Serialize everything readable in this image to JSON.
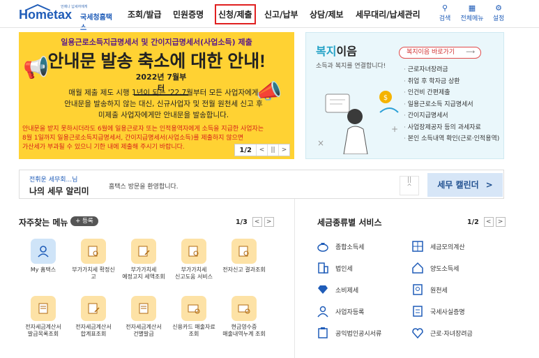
{
  "header": {
    "logo_sub": "언제나 납세자에게",
    "logo_main": "Hometax",
    "logo_kr": "국세청홈택스",
    "nav": [
      "조회/발급",
      "민원증명",
      "신청/제출",
      "신고/납부",
      "상담/제보",
      "세무대리/납세관리"
    ],
    "utils": {
      "search": "검색",
      "allmenu": "전체메뉴",
      "settings": "설정"
    }
  },
  "banner": {
    "line1": "일용근로소득지급명세서 및 간이지급명세서(사업소득) 제출",
    "line2": "안내문 발송 축소에 대한 안내!",
    "date": "2022년 7월부터",
    "body1": "매월 제출 제도 시행 1년이 되는 '22.7월부터 모든 사업자에게",
    "body2": "안내문을 발송하지 않는 대신, 신규사업자 및 전월 원천세 신고 후",
    "body3": "미제출 사업자에게만 안내문을 발송합니다.",
    "red1": "안내문을 받지 못하시더라도 6월에 일용근로자 또는 인적용역자에게 소득을 지급한 사업자는",
    "red2": "8월 1일까지 일용근로소득지급명세서, 간이지급명세서(사업소득)를 제출하지 않으면",
    "red3": "가산세가 부과될 수 있으니 기한 내에 제출해 주시기 바랍니다.",
    "page": "1/2"
  },
  "welfare": {
    "title_a": "복지",
    "title_b": "이음",
    "subtitle": "소득과 복지를 연결합니다!",
    "button": "복지이음 바로가기",
    "items": [
      "근로자녀장려금",
      "취업 후 학자금 상환",
      "인건비 간편제출",
      "일용근로소득 지급명세서",
      "간이지급명세서",
      "사업장제공자 등의 과세자료",
      "본인 소득내역 확인(근로·인적용역)"
    ]
  },
  "notice": {
    "small": "전휘운 세무회...님",
    "big": "나의 세무 알리미",
    "message": "홈택스 방문을 환영합니다.",
    "calendar": "세무 캘린더"
  },
  "favorites": {
    "title": "자주찾는 메뉴",
    "add": "+ 등록",
    "page": "1/3",
    "items": [
      {
        "label1": "My 홈택스",
        "label2": "",
        "icon": "user-icon"
      },
      {
        "label1": "부가가치세 확정신",
        "label2": "고",
        "icon": "document-search-icon"
      },
      {
        "label1": "부가가치세",
        "label2": "예정고지 세액조회",
        "icon": "document-edit-icon"
      },
      {
        "label1": "부가가치세",
        "label2": "신고도움 서비스",
        "icon": "document-search-icon"
      },
      {
        "label1": "전자신고 결과조회",
        "label2": "",
        "icon": "document-search-icon"
      },
      {
        "label1": "전자세금계산서",
        "label2": "발급목록조회",
        "icon": "receipt-icon"
      },
      {
        "label1": "전자세금계산서",
        "label2": "합계표조회",
        "icon": "document-edit-icon"
      },
      {
        "label1": "전자세금계산서",
        "label2": "건별발급",
        "icon": "receipt-icon"
      },
      {
        "label1": "신용카드 매출자료",
        "label2": "조회",
        "icon": "card-search-icon"
      },
      {
        "label1": "현금영수증",
        "label2": "매출내역누계 조회",
        "icon": "card-search-icon"
      }
    ]
  },
  "services": {
    "title": "세금종류별 서비스",
    "page": "1/2",
    "items": [
      {
        "label": "종합소득세",
        "icon": "money-bag-icon"
      },
      {
        "label": "세금모의계산",
        "icon": "calculator-icon"
      },
      {
        "label": "법인세",
        "icon": "building-icon"
      },
      {
        "label": "양도소득세",
        "icon": "house-icon"
      },
      {
        "label": "소비제세",
        "icon": "gem-icon"
      },
      {
        "label": "원천세",
        "icon": "id-card-icon"
      },
      {
        "label": "사업자등록",
        "icon": "person-icon"
      },
      {
        "label": "국세사실증명",
        "icon": "certificate-icon"
      },
      {
        "label": "공익법인공시서류",
        "icon": "clipboard-icon"
      },
      {
        "label": "근로·자녀장려금",
        "icon": "heart-icon"
      }
    ]
  },
  "colors": {
    "brand": "#1f5cb8",
    "banner": "#ffd233",
    "welfare_bg": "#eaf7fb",
    "alert": "#d6201a"
  }
}
